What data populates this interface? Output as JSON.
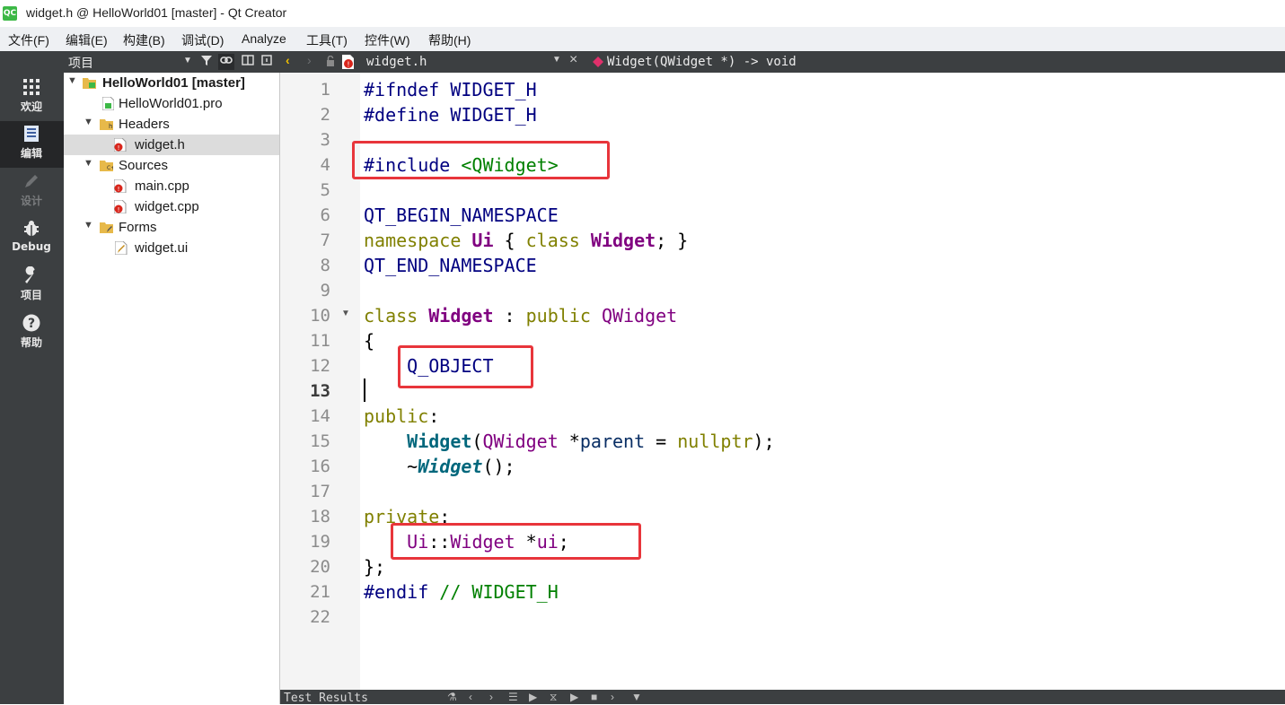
{
  "window": {
    "app_icon_text": "QC",
    "title": "widget.h @ HelloWorld01 [master] - Qt Creator"
  },
  "menu": [
    "文件(F)",
    "编辑(E)",
    "构建(B)",
    "调试(D)",
    "Analyze",
    "工具(T)",
    "控件(W)",
    "帮助(H)"
  ],
  "modes": [
    {
      "label": "欢迎",
      "icon": "grid-icon"
    },
    {
      "label": "编辑",
      "icon": "document-icon"
    },
    {
      "label": "设计",
      "icon": "pencil-icon"
    },
    {
      "label": "Debug",
      "icon": "bug-icon"
    },
    {
      "label": "项目",
      "icon": "wrench-icon"
    },
    {
      "label": "帮助",
      "icon": "help-icon"
    }
  ],
  "project_panel": {
    "title": "项目",
    "tree": [
      {
        "label": "HelloWorld01 [master]",
        "icon": "project-folder-icon"
      },
      {
        "label": "HelloWorld01.pro",
        "icon": "pro-file-icon"
      },
      {
        "label": "Headers",
        "icon": "folder-icon"
      },
      {
        "label": "widget.h",
        "icon": "header-file-icon"
      },
      {
        "label": "Sources",
        "icon": "folder-icon"
      },
      {
        "label": "main.cpp",
        "icon": "cpp-file-icon"
      },
      {
        "label": "widget.cpp",
        "icon": "cpp-file-icon"
      },
      {
        "label": "Forms",
        "icon": "folder-icon"
      },
      {
        "label": "widget.ui",
        "icon": "ui-file-icon"
      }
    ]
  },
  "editor": {
    "file_name": "widget.h",
    "symbol": "Widget(QWidget *) -> void",
    "current_line": 13,
    "line_numbers": [
      "1",
      "2",
      "3",
      "4",
      "5",
      "6",
      "7",
      "8",
      "9",
      "10",
      "11",
      "12",
      "13",
      "14",
      "15",
      "16",
      "17",
      "18",
      "19",
      "20",
      "21",
      "22"
    ],
    "code": {
      "l1": {
        "a": "#ifndef WIDGET_H"
      },
      "l2": {
        "a": "#define WIDGET_H"
      },
      "l4": {
        "a": "#include ",
        "b": "<QWidget>"
      },
      "l6": {
        "a": "QT_BEGIN_NAMESPACE"
      },
      "l7": {
        "a": "namespace",
        "b": " ",
        "c": "Ui",
        "d": " { ",
        "e": "class",
        "f": " ",
        "g": "Widget",
        "h": "; }"
      },
      "l8": {
        "a": "QT_END_NAMESPACE"
      },
      "l10": {
        "a": "class",
        "b": " ",
        "c": "Widget",
        "d": " : ",
        "e": "public",
        "f": " ",
        "g": "QWidget"
      },
      "l11": {
        "a": "{"
      },
      "l12": {
        "a": "    ",
        "b": "Q_OBJECT"
      },
      "l14": {
        "a": "public",
        "b": ":"
      },
      "l15": {
        "a": "    ",
        "b": "Widget",
        "c": "(",
        "d": "QWidget",
        "e": " *",
        "f": "parent",
        "g": " = ",
        "h": "nullptr",
        "i": ");"
      },
      "l16": {
        "a": "    ~",
        "b": "Widget",
        "c": "();"
      },
      "l18": {
        "a": "private",
        "b": ":"
      },
      "l19": {
        "a": "    ",
        "b": "Ui",
        "c": "::",
        "d": "Widget",
        "e": " *",
        "f": "ui",
        "g": ";"
      },
      "l20": {
        "a": "};"
      },
      "l21": {
        "a": "#endif",
        "b": " // WIDGET_H"
      }
    }
  },
  "output_pane": {
    "label": "Test Results"
  }
}
